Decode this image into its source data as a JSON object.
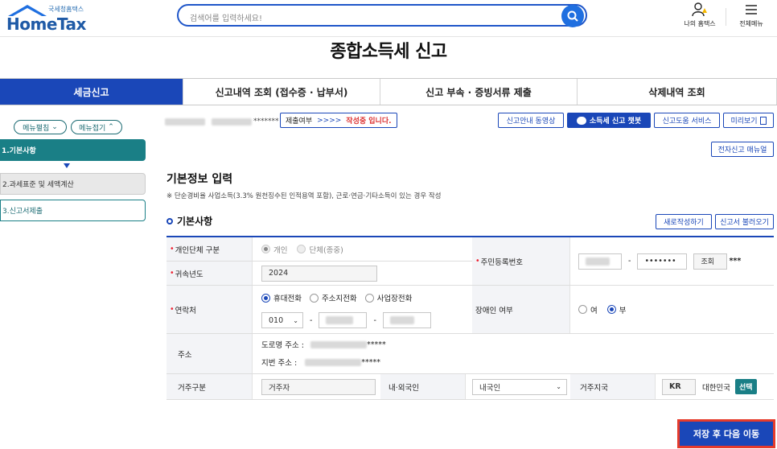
{
  "header": {
    "logo_sub": "국세청홈택스",
    "logo_main": "HomeTax",
    "search_placeholder": "검색어를 입력하세요!",
    "my_hometax": "나의 홈택스",
    "all_menu": "전체메뉴"
  },
  "page_title": "종합소득세 신고",
  "tabs": [
    {
      "label": "세금신고",
      "active": true
    },
    {
      "label": "신고내역 조회 (접수증 · 납부서)"
    },
    {
      "label": "신고 부속 · 증빙서류 제출"
    },
    {
      "label": "삭제내역 조회"
    }
  ],
  "sidebar": {
    "expand": "메뉴펼침",
    "collapse": "메뉴접기",
    "steps": [
      "1.기본사항",
      "2.과세표준 및 세액계산",
      "3.신고서제출"
    ]
  },
  "status": {
    "masked_id": "*******",
    "submit_label": "제출여부",
    "submit_arrow": ">>>>",
    "submit_state": "작성중 입니다."
  },
  "top_buttons": {
    "video": "신고안내 동영상",
    "chatbot": "소득세 신고 챗봇",
    "help": "신고도움 서비스",
    "preview": "미리보기",
    "manual": "전자신고 매뉴얼"
  },
  "section": {
    "title": "기본정보 입력",
    "note": "※ 단순경비율 사업소득(3.3% 원천징수된 인적용역 포함), 근로·연금·기타소득이 있는 경우 작성",
    "sub_title": "기본사항",
    "new_btn": "새로작성하기",
    "load_btn": "신고서 불러오기"
  },
  "form": {
    "entity_label": "개인단체 구분",
    "entity_opt1": "개인",
    "entity_opt2": "단체(종중)",
    "rrn_label": "주민등록번호",
    "rrn_dash": "-",
    "rrn_masked": "•••••••",
    "rrn_lookup": "조회",
    "rrn_suffix": "***",
    "year_label": "귀속년도",
    "year_value": "2024",
    "contact_label": "연락처",
    "contact_opt1": "휴대전화",
    "contact_opt2": "주소지전화",
    "contact_opt3": "사업장전화",
    "phone_prefix": "010",
    "phone_dash": "-",
    "disabled_label": "장애인 여부",
    "disabled_yes": "여",
    "disabled_no": "부",
    "address_label": "주소",
    "road_address": "도로명 주소 :",
    "road_mask": "*****",
    "lot_address": "지번 주소 :",
    "lot_mask": "*****",
    "residence_label": "거주구분",
    "residence_value": "거주자",
    "nationality_label": "내·외국인",
    "nationality_value": "내국인",
    "country_label": "거주지국",
    "country_code": "KR",
    "country_name": "대한민국",
    "select_btn": "선택"
  },
  "save_button": "저장 후 다음 이동",
  "colors": {
    "primary": "#1a47b8",
    "teal": "#1a7f86",
    "alert": "#e53b2c"
  }
}
